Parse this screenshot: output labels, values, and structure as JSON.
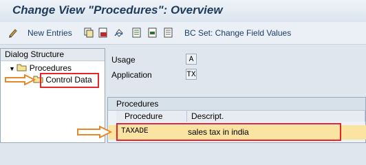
{
  "window": {
    "title": "Change View \"Procedures\": Overview"
  },
  "toolbar": {
    "new_entries": "New Entries",
    "bc_set": "BC Set: Change Field Values"
  },
  "dialog_structure": {
    "title": "Dialog Structure",
    "items": [
      {
        "label": "Procedures"
      },
      {
        "label": "Control Data"
      }
    ]
  },
  "fields": {
    "usage": {
      "label": "Usage",
      "value": "A"
    },
    "application": {
      "label": "Application",
      "value": "TX"
    }
  },
  "table": {
    "title": "Procedures",
    "columns": [
      "Procedure",
      "Descript."
    ],
    "rows": [
      {
        "procedure": "TAXADE",
        "description": "sales tax in india"
      }
    ]
  },
  "annotation_color": "#e8242b",
  "arrow_color": "#e8862a"
}
